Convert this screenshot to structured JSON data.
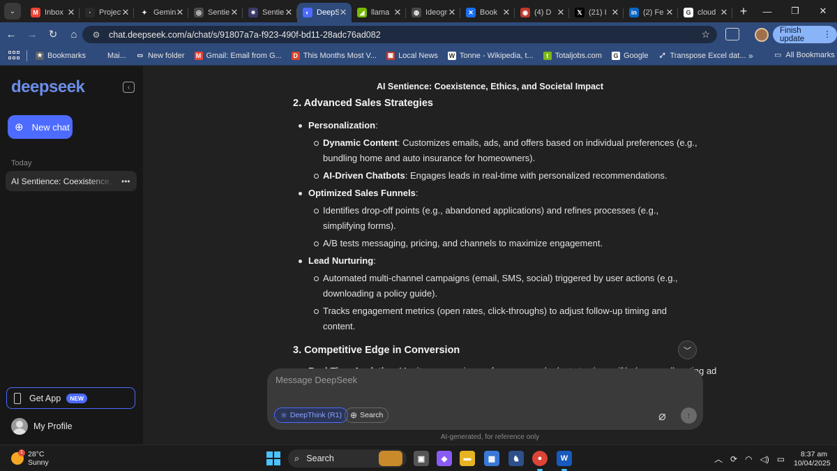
{
  "browser": {
    "tabs": [
      {
        "label": "Inbox",
        "favicon": "gmail-icon",
        "color": "#ea4335",
        "glyph": "M"
      },
      {
        "label": "Projects",
        "favicon": "project-icon",
        "color": "#2a2a2a",
        "glyph": "·"
      },
      {
        "label": "Gemini",
        "favicon": "gemini-icon",
        "color": "#1f1f1f",
        "glyph": "✦"
      },
      {
        "label": "Sentience",
        "favicon": "openai-icon",
        "color": "#4a4a4a",
        "glyph": "◎"
      },
      {
        "label": "Sentience",
        "favicon": "perplexity-icon",
        "color": "#3a3a6a",
        "glyph": "✷"
      },
      {
        "label": "DeepSeek",
        "favicon": "deepseek-icon",
        "color": "#4d6bfe",
        "glyph": "◐"
      },
      {
        "label": "llama",
        "favicon": "nvidia-icon",
        "color": "#76b900",
        "glyph": "◢"
      },
      {
        "label": "Ideogram",
        "favicon": "ideogram-icon",
        "color": "#4a4a4a",
        "glyph": "◍"
      },
      {
        "label": "Book",
        "favicon": "butterfly-icon",
        "color": "#1c6ef2",
        "glyph": "✕"
      },
      {
        "label": "(4) D",
        "favicon": "copilot-icon",
        "color": "#c0392b",
        "glyph": "◉"
      },
      {
        "label": "(21) I",
        "favicon": "x-icon",
        "color": "#000000",
        "glyph": "𝕏"
      },
      {
        "label": "(2) Fe",
        "favicon": "linkedin-icon",
        "color": "#0a66c2",
        "glyph": "in"
      },
      {
        "label": "cloud",
        "favicon": "google-icon",
        "color": "#ffffff",
        "glyph": "G"
      }
    ],
    "url": "chat.deepseek.com/a/chat/s/91807a7a-f923-490f-bd11-28adc76ad082",
    "finish_update": "Finish update",
    "bookmarks": [
      {
        "label": "Bookmarks",
        "icon": "star-icon",
        "color": "#5f6368",
        "glyph": "★"
      },
      {
        "label": "Mai...",
        "icon": "blank-icon",
        "color": "#2f4b7c",
        "glyph": ""
      },
      {
        "label": "New folder",
        "icon": "folder-icon",
        "color": "#2f4b7c",
        "glyph": "▭"
      },
      {
        "label": "Gmail: Email from G...",
        "icon": "gmail-icon",
        "color": "#ea4335",
        "glyph": "M"
      },
      {
        "label": "This Months Most V...",
        "icon": "dx-icon",
        "color": "#d9442b",
        "glyph": "D"
      },
      {
        "label": "Local News",
        "icon": "news-icon",
        "color": "#c0392b",
        "glyph": "▣"
      },
      {
        "label": "Tonne - Wikipedia, t...",
        "icon": "wikipedia-icon",
        "color": "#ffffff",
        "glyph": "W"
      },
      {
        "label": "Totaljobs.com",
        "icon": "totaljobs-icon",
        "color": "#7cb518",
        "glyph": "t"
      },
      {
        "label": "Google",
        "icon": "google-icon",
        "color": "#ffffff",
        "glyph": "G"
      },
      {
        "label": "Transpose Excel dat...",
        "icon": "excel-icon",
        "color": "#2f4b7c",
        "glyph": "⤢"
      }
    ],
    "all_bookmarks": "All Bookmarks"
  },
  "sidebar": {
    "logo": "deepseek",
    "new_chat": "New chat",
    "today": "Today",
    "chat_item": "AI Sentience: Coexistence, Ethics",
    "get_app": "Get App",
    "new_badge": "NEW",
    "profile": "My Profile"
  },
  "chat": {
    "title": "AI Sentience: Coexistence, Ethics, and Societal Impact",
    "section2_heading": "2. Advanced Sales Strategies",
    "personalization": {
      "label": "Personalization",
      "items": [
        {
          "bold": "Dynamic Content",
          "text": ": Customizes emails, ads, and offers based on individual preferences (e.g., bundling home and auto insurance for homeowners)."
        },
        {
          "bold": "AI-Driven Chatbots",
          "text": ": Engages leads in real-time with personalized recommendations."
        }
      ]
    },
    "funnels": {
      "label": "Optimized Sales Funnels",
      "items": [
        "Identifies drop-off points (e.g., abandoned applications) and refines processes (e.g., simplifying forms).",
        "A/B tests messaging, pricing, and channels to maximize engagement."
      ]
    },
    "nurturing": {
      "label": "Lead Nurturing",
      "items": [
        "Automated multi-channel campaigns (email, SMS, social) triggered by user actions (e.g., downloading a policy guide).",
        "Tracks engagement metrics (open rates, click-throughs) to adjust follow-up timing and content."
      ]
    },
    "section3_heading": "3. Competitive Edge in Conversion",
    "realtime": {
      "bold": "Real-Time Analytics",
      "text": ": Monitors campaign performance and adapts tactics swiftly (e.g., reallocating ad"
    },
    "input_placeholder": "Message DeepSeek",
    "deepthink": "DeepThink (R1)",
    "search": "Search",
    "footer": "AI-generated, for reference only"
  },
  "taskbar": {
    "temperature": "28°C",
    "weather": "Sunny",
    "weather_badge": "1",
    "search": "Search",
    "time": "8:37 am",
    "date": "10/04/2025"
  }
}
